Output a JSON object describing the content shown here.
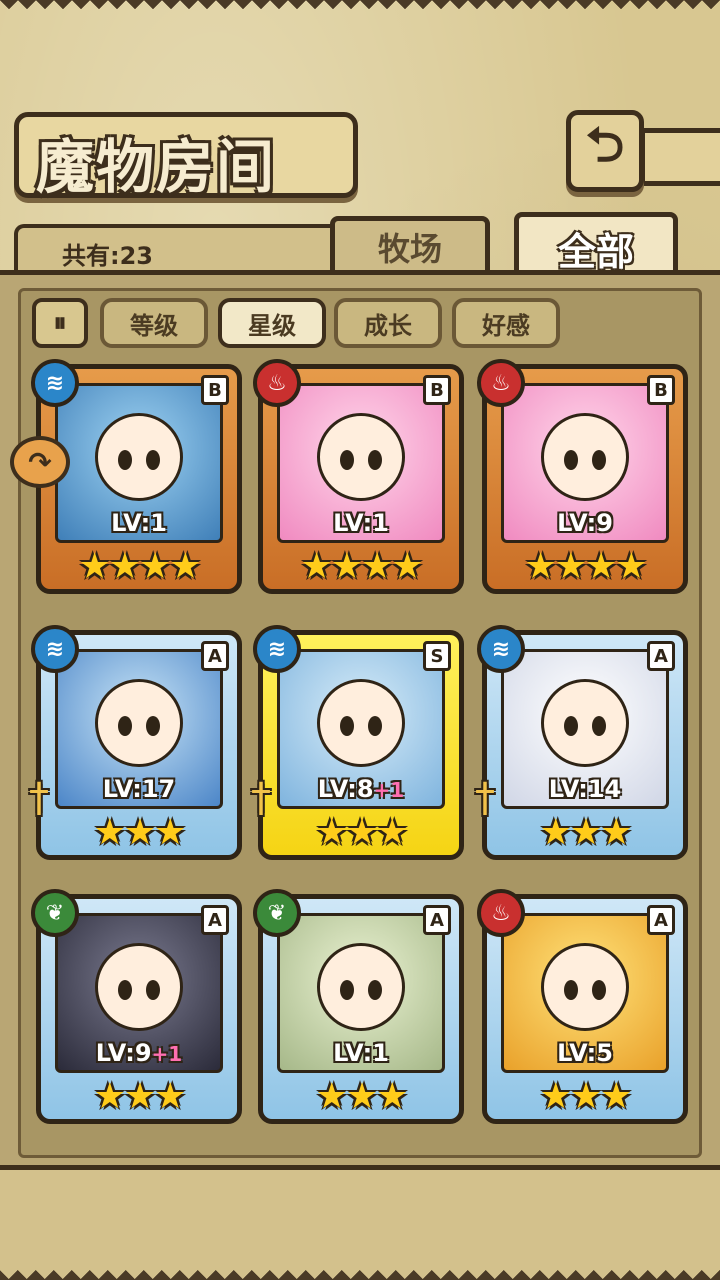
{
  "header": {
    "title": "魔物房间",
    "back_icon": "back-arrow-icon"
  },
  "summary": {
    "count_label": "共有:23"
  },
  "tabs": [
    {
      "label": "牧场",
      "active": false
    },
    {
      "label": "全部",
      "active": true
    }
  ],
  "sort": {
    "toggle_icon": "sort-order-icon",
    "options": [
      {
        "label": "等级",
        "active": false
      },
      {
        "label": "星级",
        "active": true
      },
      {
        "label": "成长",
        "active": false
      },
      {
        "label": "好感",
        "active": false
      }
    ]
  },
  "monsters": [
    {
      "lv": "LV:1",
      "plus": "",
      "rank": "B",
      "element": "water",
      "frame": "bronze",
      "stars": 4
    },
    {
      "lv": "LV:1",
      "plus": "",
      "rank": "B",
      "element": "fire",
      "frame": "bronze",
      "stars": 4
    },
    {
      "lv": "LV:9",
      "plus": "",
      "rank": "B",
      "element": "fire",
      "frame": "bronze",
      "stars": 4
    },
    {
      "lv": "LV:17",
      "plus": "",
      "rank": "A",
      "element": "water",
      "frame": "blue",
      "stars": 3
    },
    {
      "lv": "LV:8",
      "plus": "+1",
      "rank": "S",
      "element": "water",
      "frame": "gold",
      "stars": 3
    },
    {
      "lv": "LV:14",
      "plus": "",
      "rank": "A",
      "element": "water",
      "frame": "blue",
      "stars": 3
    },
    {
      "lv": "LV:9",
      "plus": "+1",
      "rank": "A",
      "element": "wood",
      "frame": "blue",
      "stars": 3
    },
    {
      "lv": "LV:1",
      "plus": "",
      "rank": "A",
      "element": "wood",
      "frame": "blue",
      "stars": 3
    },
    {
      "lv": "LV:5",
      "plus": "",
      "rank": "A",
      "element": "fire",
      "frame": "blue",
      "stars": 3
    }
  ],
  "colors": {
    "parchment": "#d8c791",
    "outline": "#3d2e1c",
    "star": "#ffcc1a",
    "plus": "#ff6fb1"
  }
}
